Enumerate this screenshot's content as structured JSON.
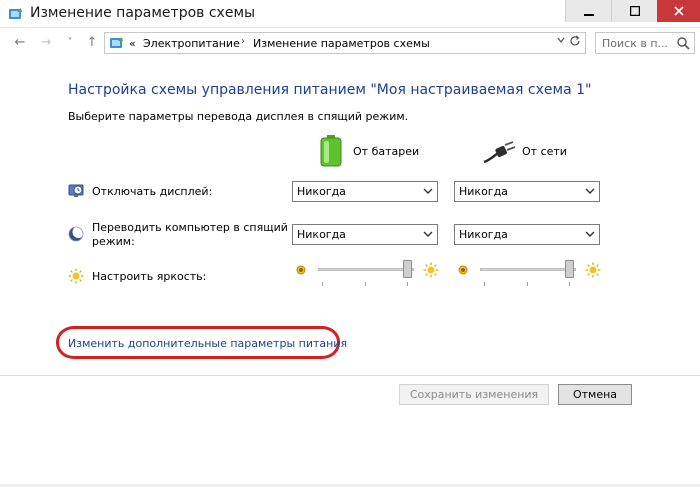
{
  "window": {
    "title": "Изменение параметров схемы",
    "controls": {
      "minimize": "–",
      "maximize": "□",
      "close": "✕"
    }
  },
  "nav": {
    "back": "←",
    "forward": "→",
    "recent": "˅",
    "up": "↑"
  },
  "address": {
    "prefix": "«",
    "crumbs": [
      "Электропитание",
      "Изменение параметров схемы"
    ],
    "separator": "›"
  },
  "search": {
    "placeholder": "Поиск в п..."
  },
  "content": {
    "heading": "Настройка схемы управления питанием \"Моя настраиваемая схема 1\"",
    "subtitle": "Выберите параметры перевода дисплея в спящий режим.",
    "columns": {
      "battery": "От батареи",
      "ac": "От сети"
    },
    "rows": {
      "display_off": {
        "label": "Отключать дисплей:",
        "battery_value": "Никогда",
        "ac_value": "Никогда"
      },
      "sleep": {
        "label_line1": "Переводить компьютер в спящий",
        "label_line2": "режим:",
        "battery_value": "Никогда",
        "ac_value": "Никогда"
      },
      "brightness": {
        "label": "Настроить яркость:",
        "battery_level": 1.0,
        "ac_level": 1.0
      }
    },
    "advanced_link": "Изменить дополнительные параметры питания"
  },
  "buttons": {
    "save": "Сохранить изменения",
    "cancel": "Отмена"
  },
  "colors": {
    "link": "#1f3f8f",
    "close_button": "#c7383a",
    "highlight_oval": "#d32020"
  }
}
